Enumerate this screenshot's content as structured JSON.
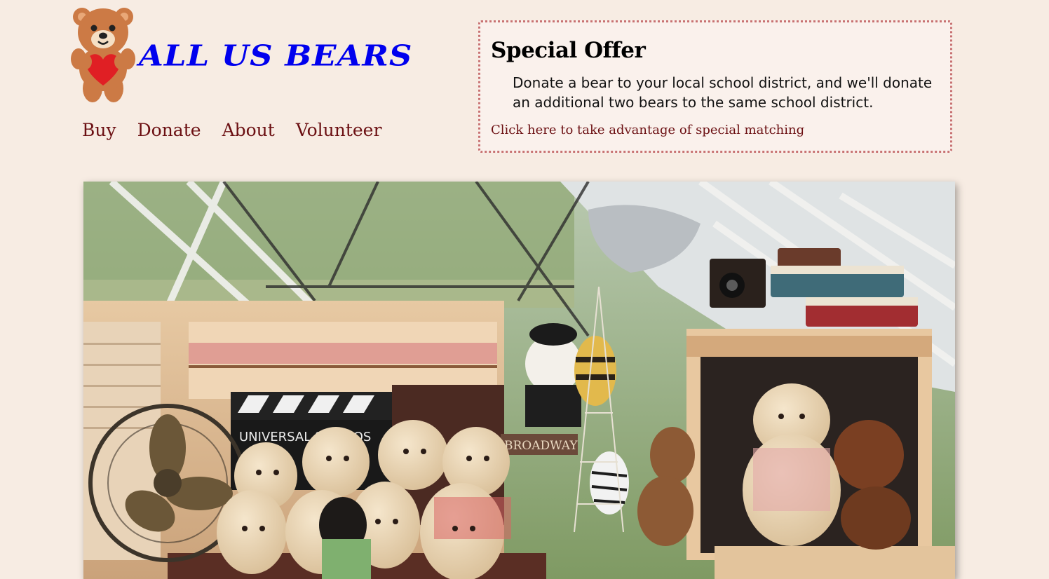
{
  "header": {
    "logo_icon": "teddy-bear-heart-logo",
    "brand_name": "ALL US BEARS",
    "brand_color": "#0000ee"
  },
  "nav": {
    "items": [
      {
        "label": "Buy"
      },
      {
        "label": "Donate"
      },
      {
        "label": "About"
      },
      {
        "label": "Volunteer"
      }
    ],
    "link_color": "#6b0f12"
  },
  "special_offer": {
    "title": "Special Offer",
    "body": "Donate a bear to your local school district, and we'll donate an additional two bears to the same school district.",
    "link_text": "Click here to take advantage of special matching",
    "border_color": "#c87272"
  },
  "hero": {
    "image": "photo-teddy-bear-shop-display",
    "clapboard_text": "UNIVERSAL STUDIOS",
    "sign_text": "BROADWAY"
  },
  "colors": {
    "background": "#f7ece3"
  }
}
